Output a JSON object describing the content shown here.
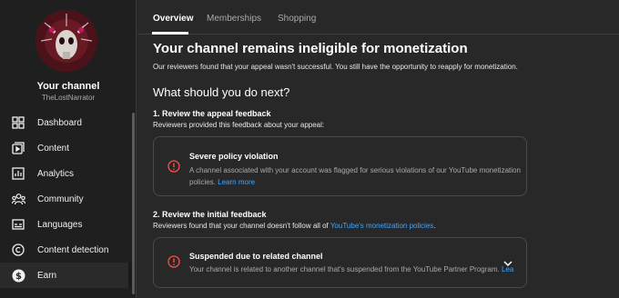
{
  "sidebar": {
    "channel_title": "Your channel",
    "channel_handle": "TheLostNarrator",
    "items": [
      {
        "label": "Dashboard",
        "icon": "dashboard-icon"
      },
      {
        "label": "Content",
        "icon": "content-icon"
      },
      {
        "label": "Analytics",
        "icon": "analytics-icon"
      },
      {
        "label": "Community",
        "icon": "community-icon"
      },
      {
        "label": "Languages",
        "icon": "languages-icon"
      },
      {
        "label": "Content detection",
        "icon": "copyright-icon"
      },
      {
        "label": "Earn",
        "icon": "earn-icon"
      }
    ],
    "active_item": "Earn"
  },
  "tabs": [
    {
      "label": "Overview",
      "active": true
    },
    {
      "label": "Memberships",
      "active": false
    },
    {
      "label": "Shopping",
      "active": false
    }
  ],
  "main": {
    "title": "Your channel remains ineligible for monetization",
    "subtitle": "Our reviewers found that your appeal wasn't successful. You still have the opportunity to reapply for monetization.",
    "next_heading": "What should you do next?",
    "step1": {
      "title": "1. Review the appeal feedback",
      "desc": "Reviewers provided this feedback about your appeal:",
      "card_title": "Severe policy violation",
      "card_text_1": "A channel associated with your account was flagged for serious violations of our YouTube monetization",
      "card_text_2": "policies.",
      "card_link": "Learn more"
    },
    "step2": {
      "title": "2. Review the initial feedback",
      "desc_prefix": "Reviewers found that your channel doesn't follow all of",
      "desc_link": "YouTube's monetization policies",
      "desc_suffix": ".",
      "card_title": "Suspended due to related channel",
      "card_text": "Your channel is related to another channel that's suspended from the YouTube Partner Program.",
      "card_link": "Lea"
    }
  },
  "colors": {
    "background": "#282828",
    "sidebar": "#1f1f1f",
    "link": "#3ea6ff",
    "warning": "#ff4e45"
  }
}
